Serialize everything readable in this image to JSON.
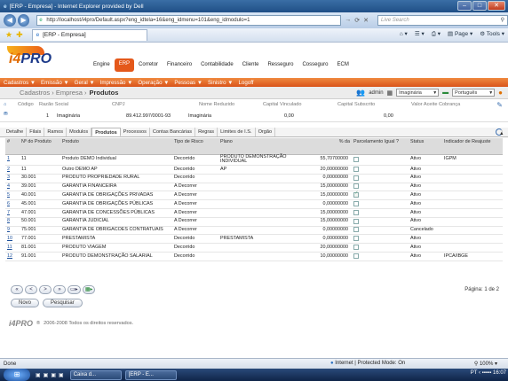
{
  "window": {
    "title": "[ERP - Empresa] - Internet Explorer provided by Dell"
  },
  "browser": {
    "url": "http://localhost/i4pro/Default.aspx?eng_idtela=16&eng_idmenu=101&eng_idmodulo=1",
    "search_placeholder": "Live Search",
    "tab_label": "[ERP - Empresa]",
    "page_menu": "Page",
    "tools_menu": "Tools"
  },
  "app": {
    "logo_text": "PRO",
    "logo_prefix": "i4",
    "nav": [
      "Engine",
      "ERP",
      "Corretor",
      "Financeiro",
      "Contabilidade",
      "Cliente",
      "Resseguro",
      "Cosseguro",
      "ECM"
    ],
    "active_nav": "ERP",
    "submenu": [
      "Cadastros ▼",
      "Emissão ▼",
      "Geral ▼",
      "Impressão ▼",
      "Operação ▼",
      "Pessoas ▼",
      "Sinistro ▼",
      "Logoff"
    ]
  },
  "breadcrumb": {
    "root": "Cadastros",
    "mid": "Empresa",
    "current": "Produtos",
    "user": "admin",
    "company_select": "Imaginária",
    "language_select": "Português"
  },
  "summary": {
    "headers": [
      "Código",
      "Razão Social",
      "CNPJ",
      "Nome Reduzido",
      "Capital Vinculado",
      "Capital Subscrito",
      "Valor Aceite Cobrança"
    ],
    "values": [
      "1",
      "Imaginária",
      "89.412.997/0001-93",
      "Imaginária",
      "0,00",
      "0,00",
      ""
    ]
  },
  "tabs": [
    "Detalhe",
    "Filais",
    "Ramos",
    "Modulos",
    "Produtos",
    "Processos",
    "Contas Bancárias",
    "Regras",
    "Limites de I.S.",
    "Orgão"
  ],
  "active_tab": "Produtos",
  "table": {
    "columns": [
      "#",
      "Nº do Produto",
      "Produto",
      "Tipo de Risco",
      "Plano",
      "% da",
      "Parcelamento Igual ?",
      "Status",
      "Indicador de Reajuste"
    ],
    "rows": [
      {
        "idx": "1",
        "num": "11",
        "produto": "Produto DEMO Individual",
        "tipo": "Decorrido",
        "plano": "PRODUTO DEMONSTRAÇÃO INDIVIDUAL",
        "pct": "55,70700000",
        "parc": false,
        "status": "Ativo",
        "reajuste": "IGPM"
      },
      {
        "idx": "2",
        "num": "11",
        "produto": "Outro DEMO AP",
        "tipo": "Decorrido",
        "plano": "AP",
        "pct": "20,00000000",
        "parc": false,
        "status": "Ativo",
        "reajuste": ""
      },
      {
        "idx": "3",
        "num": "30.001",
        "produto": "PRODUTO PROPRIEDADE RURAL",
        "tipo": "Decorrido",
        "plano": "",
        "pct": "0,00000000",
        "parc": false,
        "status": "Ativo",
        "reajuste": ""
      },
      {
        "idx": "4",
        "num": "39.001",
        "produto": "GARANTIA FINANCEIRA",
        "tipo": "A Decorrer",
        "plano": "",
        "pct": "15,00000000",
        "parc": false,
        "status": "Ativo",
        "reajuste": ""
      },
      {
        "idx": "5",
        "num": "40.001",
        "produto": "GARANTIA DE OBRIGAÇÕES PRIVADAS",
        "tipo": "A Decorrer",
        "plano": "",
        "pct": "15,00000000",
        "parc": true,
        "status": "Ativo",
        "reajuste": ""
      },
      {
        "idx": "6",
        "num": "45.001",
        "produto": "GARANTIA DE OBRIGAÇÕES PÚBLICAS",
        "tipo": "A Decorrer",
        "plano": "",
        "pct": "0,00000000",
        "parc": false,
        "status": "Ativo",
        "reajuste": ""
      },
      {
        "idx": "7",
        "num": "47.001",
        "produto": "GARANTIA DE CONCESSÕES PÚBLICAS",
        "tipo": "A Decorrer",
        "plano": "",
        "pct": "15,00000000",
        "parc": false,
        "status": "Ativo",
        "reajuste": ""
      },
      {
        "idx": "8",
        "num": "50.001",
        "produto": "GARANTIA JUDICIAL",
        "tipo": "A Decorrer",
        "plano": "",
        "pct": "15,00000000",
        "parc": false,
        "status": "Ativo",
        "reajuste": ""
      },
      {
        "idx": "9",
        "num": "75.001",
        "produto": "GARANTIA DE OBRIGACOES CONTRATUAIS",
        "tipo": "A Decorrer",
        "plano": "",
        "pct": "0,00000000",
        "parc": false,
        "status": "Cancelado",
        "reajuste": ""
      },
      {
        "idx": "10",
        "num": "77.001",
        "produto": "PRESTAMISTA",
        "tipo": "Decorrido",
        "plano": "PRESTAMISTA",
        "pct": "0,00000000",
        "parc": false,
        "status": "Ativo",
        "reajuste": ""
      },
      {
        "idx": "11",
        "num": "81.001",
        "produto": "PRODUTO VIAGEM",
        "tipo": "Decorrido",
        "plano": "",
        "pct": "20,00000000",
        "parc": false,
        "status": "Ativo",
        "reajuste": ""
      },
      {
        "idx": "12",
        "num": "91.001",
        "produto": "PRODUTO DEMONSTRAÇÃO SALARIAL",
        "tipo": "Decorrido",
        "plano": "",
        "pct": "10,00000000",
        "parc": false,
        "status": "Ativo",
        "reajuste": "IPCA/IBGE"
      }
    ]
  },
  "pager": {
    "info": "Página: 1 de 2",
    "buttons": [
      "«",
      "<",
      ">",
      "»"
    ]
  },
  "actions": {
    "new_label": "Novo",
    "search_label": "Pesquisar"
  },
  "footer": {
    "copyright": "2006-2008 Todos os direitos reservados."
  },
  "status": {
    "left": "Done",
    "zone": "Internet | Protected Mode: On",
    "zoom": "100%"
  },
  "taskbar": {
    "tasks": [
      "Caixa d...",
      "[ERP - E..."
    ],
    "time": "16:07",
    "lang": "PT"
  }
}
